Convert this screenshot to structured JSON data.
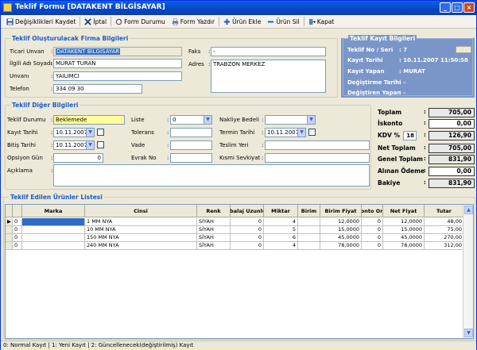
{
  "window": {
    "title": "Teklif Formu [DATAKENT BİLGİSAYAR]"
  },
  "toolbar": {
    "save": "Değişiklikleri Kaydet",
    "cancel": "İptal",
    "form_status": "Form Durumu",
    "print_form": "Form Yazdır",
    "add_product": "Ürün Ekle",
    "delete_product": "Ürün Sil",
    "close": "Kapat"
  },
  "company": {
    "title": "Teklif Oluşturulacak Firma Bilgileri",
    "trade_title_label": "Ticari Unvan",
    "trade_title": "DATAKENT BİLGİSAYAR",
    "contact_label": "İlgili Adı Soyadı",
    "contact": "MURAT TURAN",
    "position_label": "Unvanı",
    "position": "YAILIMCI",
    "phone_label": "Telefon",
    "phone": "334 09 30",
    "fax_label": "Faks",
    "fax": "-",
    "address_label": "Adres",
    "address": "TRABZON MERKEZ"
  },
  "record": {
    "title": "Teklif Kayıt Bilgileri",
    "no_label": "Teklif No / Seri",
    "no_value": ": 7",
    "date_label": "Kayıt Tarihi",
    "date_value": ": 10.11.2007 11:50:58",
    "by_label": "Kayıt Yapan",
    "by_value": ": MURAT",
    "modified_date_label": "Değiştirme Tarihi",
    "modified_date_value": ": -",
    "modified_by_label": "Değiştiren Yapan",
    "modified_by_value": ": -"
  },
  "other": {
    "title": "Teklif Diğer Bilgileri",
    "status_label": "Teklif Durumu",
    "status": "Beklemede",
    "rec_date_label": "Kayıt Tarihi",
    "rec_date": "10.11.2007",
    "end_date_label": "Bitiş Tarihi",
    "end_date": "10.11.2007",
    "option_label": "Opsiyon Gün",
    "option": "0",
    "note_label": "Açıklama",
    "list_label": "Liste",
    "list": "0",
    "tolerance_label": "Tolerans",
    "term_label": "Vade",
    "doc_no_label": "Evrak No",
    "shipping_cost_label": "Nakliye Bedeli",
    "delivery_date_label": "Termin Tarihi",
    "delivery_date": "10.11.2007",
    "delivery_place_label": "Teslim Yeri",
    "partial_ship_label": "Kısmi Sevkiyat"
  },
  "totals": {
    "total_label": "Toplam",
    "total": "705,00",
    "discount_label": "İskonto",
    "discount": "0,00",
    "vat_label": "KDV %",
    "vat_rate": "18",
    "vat": "126,90",
    "net_label": "Net Toplam",
    "net": "705,00",
    "grand_label": "Genel Toplam",
    "grand": "831,90",
    "received_label": "Alınan Ödeme",
    "received": "0,00",
    "balance_label": "Bakiye",
    "balance": "831,90"
  },
  "products": {
    "title": "Teklif Edilen Ürünler Listesi",
    "columns": [
      "Marka",
      "Cinsi",
      "Renk",
      "Ambalaj Uzunluğu",
      "Miktar",
      "Birim",
      "Birim Fiyat",
      "İskonto Oranı",
      "Net Fiyat",
      "Tutar"
    ],
    "rows": [
      {
        "state": "0",
        "brand": "",
        "type": "1 MM NYA",
        "color": "SİYAH",
        "pack": "0",
        "qty": "4",
        "unit": "",
        "unit_price": "12,0000",
        "disc": "0",
        "net": "12,0000",
        "amount": "48,00"
      },
      {
        "state": "0",
        "brand": "",
        "type": "10 MM NYA",
        "color": "SİYAH",
        "pack": "0",
        "qty": "5",
        "unit": "",
        "unit_price": "15,0000",
        "disc": "0",
        "net": "15,0000",
        "amount": "75,00"
      },
      {
        "state": "0",
        "brand": "",
        "type": "150 MM NYA",
        "color": "SİYAH",
        "pack": "0",
        "qty": "6",
        "unit": "",
        "unit_price": "45,0000",
        "disc": "0",
        "net": "45,0000",
        "amount": "270,00"
      },
      {
        "state": "0",
        "brand": "",
        "type": "240 MM NYA",
        "color": "SİYAH",
        "pack": "0",
        "qty": "4",
        "unit": "",
        "unit_price": "78,0000",
        "disc": "0",
        "net": "78,0000",
        "amount": "312,00"
      }
    ]
  },
  "status_bar": "0: Normal Kayıt | 1: Yeni Kayıt | 2: Güncellenecek(değiştirilmiş) Kayıt"
}
